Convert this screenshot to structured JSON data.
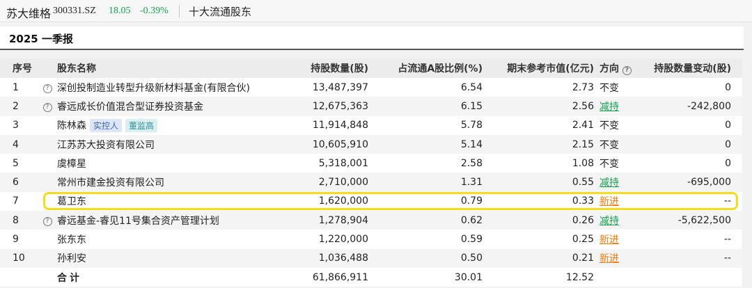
{
  "header": {
    "stock_name": "苏大维格",
    "stock_code": "300331.SZ",
    "price": "18.05",
    "change": "-0.39%",
    "section_title": "十大流通股东"
  },
  "period_title": "2025 一季报",
  "table": {
    "columns": [
      "序号",
      "股东名称",
      "持股数量(股)",
      "占流通A股比例(%)",
      "期末参考市值(亿元)",
      "方向",
      "持股数量变动(股)"
    ],
    "rows": [
      {
        "idx": "1",
        "help": true,
        "name": "深创投制造业转型升级新材料基金(有限合伙)",
        "tags": [],
        "shares": "13,487,397",
        "ratio": "6.54",
        "value": "2.73",
        "direction": "不变",
        "dir_type": "same",
        "change": "0"
      },
      {
        "idx": "2",
        "help": true,
        "name": "睿远成长价值混合型证券投资基金",
        "tags": [],
        "shares": "12,675,363",
        "ratio": "6.15",
        "value": "2.56",
        "direction": "减持",
        "dir_type": "reduce",
        "change": "-242,800"
      },
      {
        "idx": "3",
        "help": false,
        "name": "陈林森",
        "tags": [
          "实控人",
          "董监高"
        ],
        "shares": "11,914,848",
        "ratio": "5.78",
        "value": "2.41",
        "direction": "不变",
        "dir_type": "same",
        "change": "0"
      },
      {
        "idx": "4",
        "help": false,
        "name": "江苏苏大投资有限公司",
        "tags": [],
        "shares": "10,605,910",
        "ratio": "5.14",
        "value": "2.15",
        "direction": "不变",
        "dir_type": "same",
        "change": "0"
      },
      {
        "idx": "5",
        "help": false,
        "name": "虞樟星",
        "tags": [],
        "shares": "5,318,001",
        "ratio": "2.58",
        "value": "1.08",
        "direction": "不变",
        "dir_type": "same",
        "change": "0"
      },
      {
        "idx": "6",
        "help": false,
        "name": "常州市建金投资有限公司",
        "tags": [],
        "shares": "2,710,000",
        "ratio": "1.31",
        "value": "0.55",
        "direction": "减持",
        "dir_type": "reduce",
        "change": "-695,000"
      },
      {
        "idx": "7",
        "help": false,
        "name": "葛卫东",
        "tags": [],
        "shares": "1,620,000",
        "ratio": "0.79",
        "value": "0.33",
        "direction": "新进",
        "dir_type": "new",
        "change": "--"
      },
      {
        "idx": "8",
        "help": true,
        "name": "睿远基金-睿见11号集合资产管理计划",
        "tags": [],
        "shares": "1,278,904",
        "ratio": "0.62",
        "value": "0.26",
        "direction": "减持",
        "dir_type": "reduce",
        "change": "-5,622,500"
      },
      {
        "idx": "9",
        "help": false,
        "name": "张东东",
        "tags": [],
        "shares": "1,220,000",
        "ratio": "0.59",
        "value": "0.25",
        "direction": "新进",
        "dir_type": "new",
        "change": "--"
      },
      {
        "idx": "10",
        "help": false,
        "name": "孙利安",
        "tags": [],
        "shares": "1,036,488",
        "ratio": "0.50",
        "value": "0.21",
        "direction": "新进",
        "dir_type": "new",
        "change": "--"
      }
    ],
    "total": {
      "label": "合计",
      "shares": "61,866,911",
      "ratio": "30.01",
      "value": "12.52"
    }
  },
  "colors": {
    "up_down_green": "#14a14d",
    "new_orange": "#ef7d12",
    "highlight": "#f2de1f"
  },
  "icons": {
    "help": "question-circle-icon"
  }
}
